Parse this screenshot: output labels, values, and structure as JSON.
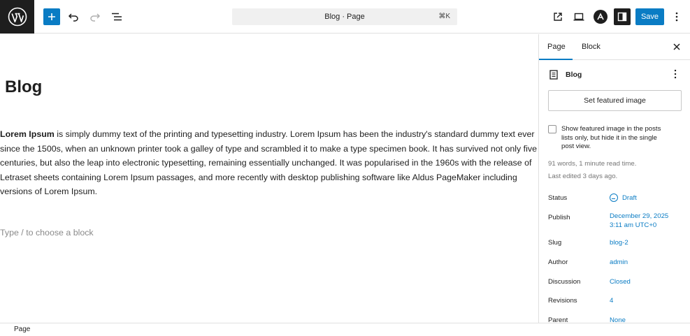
{
  "toolbar": {
    "logo_icon": "wordpress-logo-icon",
    "add_icon": "plus-icon",
    "undo_icon": "undo-icon",
    "redo_icon": "redo-icon",
    "list_view_icon": "list-view-icon",
    "command_bar_text": "Blog · Page",
    "command_shortcut": "⌘K",
    "view_icon": "external-view-icon",
    "device_icon": "desktop-device-icon",
    "astra_icon": "astra-logo-icon",
    "settings_icon": "sidebar-settings-icon",
    "save_label": "Save",
    "more_icon": "vertical-ellipsis-icon"
  },
  "editor": {
    "title": "Blog",
    "paragraph_bold": "Lorem Ipsum",
    "paragraph_rest": " is simply dummy text of the printing and typesetting industry. Lorem Ipsum has been the industry's standard dummy text ever since the 1500s, when an unknown printer took a galley of type and scrambled it to make a type specimen book. It has survived not only five centuries, but also the leap into electronic typesetting, remaining essentially unchanged. It was popularised in the 1960s with the release of Letraset sheets containing Lorem Ipsum passages, and more recently with desktop publishing software like Aldus PageMaker including versions of Lorem Ipsum.",
    "placeholder": "Type / to choose a block"
  },
  "sidebar": {
    "tabs": [
      {
        "label": "Page",
        "active": true
      },
      {
        "label": "Block",
        "active": false
      }
    ],
    "close_icon": "close-icon",
    "document_icon": "page-document-icon",
    "document_title": "Blog",
    "document_more_icon": "vertical-ellipsis-icon",
    "featured_image_label": "Set featured image",
    "featured_checkbox_label": "Show featured image in the posts lists only, but hide it in the single post view.",
    "featured_checkbox_checked": false,
    "word_count": "91 words, 1 minute read time.",
    "last_edited": "Last edited 3 days ago.",
    "rows": [
      {
        "label": "Status",
        "value": "Draft"
      },
      {
        "label": "Publish",
        "value_line1": "December 29, 2025",
        "value_line2": "3:11 am UTC+0"
      },
      {
        "label": "Slug",
        "value": "blog-2"
      },
      {
        "label": "Author",
        "value": "admin"
      },
      {
        "label": "Discussion",
        "value": "Closed"
      },
      {
        "label": "Revisions",
        "value": "4"
      },
      {
        "label": "Parent",
        "value": "None"
      }
    ],
    "status_icon": "draft-status-icon"
  },
  "footer": {
    "breadcrumb": "Page"
  },
  "colors": {
    "accent": "#0a7cc4",
    "dark": "#1e1e1e",
    "muted": "#757575"
  }
}
